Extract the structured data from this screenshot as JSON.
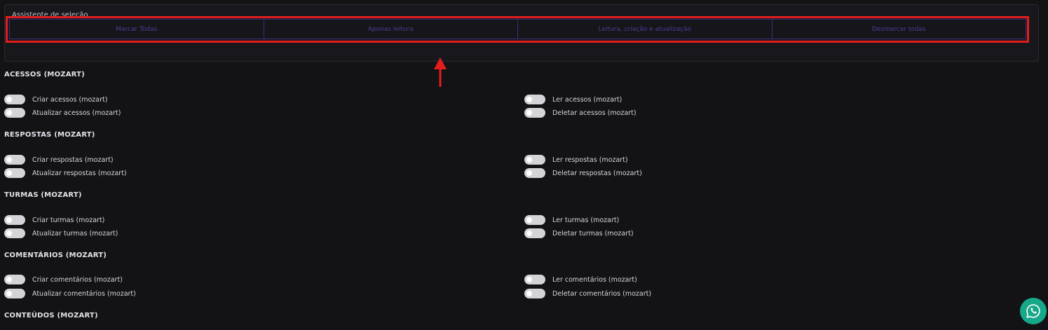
{
  "assistant": {
    "title": "Assistente de seleção",
    "buttons": [
      {
        "label": "Marcar Todas"
      },
      {
        "label": "Apenas leitura"
      },
      {
        "label": "Leitura, criação e atualização"
      },
      {
        "label": "Desmarcar todas"
      }
    ]
  },
  "sections": [
    {
      "title": "ACESSOS (MOZART)",
      "create": "Criar acessos (mozart)",
      "read": "Ler acessos (mozart)",
      "update": "Atualizar acessos (mozart)",
      "delete": "Deletar acessos (mozart)"
    },
    {
      "title": "RESPOSTAS (MOZART)",
      "create": "Criar respostas (mozart)",
      "read": "Ler respostas (mozart)",
      "update": "Atualizar respostas (mozart)",
      "delete": "Deletar respostas (mozart)"
    },
    {
      "title": "TURMAS (MOZART)",
      "create": "Criar turmas (mozart)",
      "read": "Ler turmas (mozart)",
      "update": "Atualizar turmas (mozart)",
      "delete": "Deletar turmas (mozart)"
    },
    {
      "title": "COMENTÁRIOS (MOZART)",
      "create": "Criar comentários (mozart)",
      "read": "Ler comentários (mozart)",
      "update": "Atualizar comentários (mozart)",
      "delete": "Deletar comentários (mozart)"
    },
    {
      "title": "CONTEÚDOS (MOZART)"
    }
  ],
  "toggles_state": "off",
  "colors": {
    "accent_purple": "#4a3d94",
    "highlight_red": "#e11d1d",
    "whatsapp_green": "#17a889"
  },
  "icons": {
    "annotation": "arrow-up-icon",
    "chat": "whatsapp-icon"
  }
}
